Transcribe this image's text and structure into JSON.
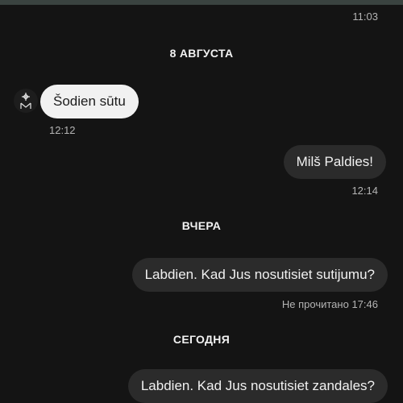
{
  "chat": {
    "top_time": "11:03",
    "sections": [
      {
        "date_label": "8 АВГУСТА",
        "messages": [
          {
            "direction": "incoming",
            "text": "Šodien sūtu",
            "time": "12:12"
          },
          {
            "direction": "outgoing",
            "text": "Milš Paldies!",
            "time": "12:14"
          }
        ]
      },
      {
        "date_label": "ВЧЕРА",
        "messages": [
          {
            "direction": "outgoing",
            "text": "Labdien. Kad Jus nosutisiet sutijumu?",
            "status": "Не прочитано",
            "time": "17:46"
          }
        ]
      },
      {
        "date_label": "СЕГОДНЯ",
        "messages": [
          {
            "direction": "outgoing",
            "text": "Labdien. Kad Jus nosutisiet zandales?"
          }
        ]
      }
    ]
  },
  "icons": {
    "avatar": "brand-logo-icon"
  },
  "colors": {
    "background": "#141414",
    "incoming_bubble": "#f1f1f1",
    "outgoing_bubble": "#2b2b2b",
    "top_strip": "#3a4340"
  }
}
